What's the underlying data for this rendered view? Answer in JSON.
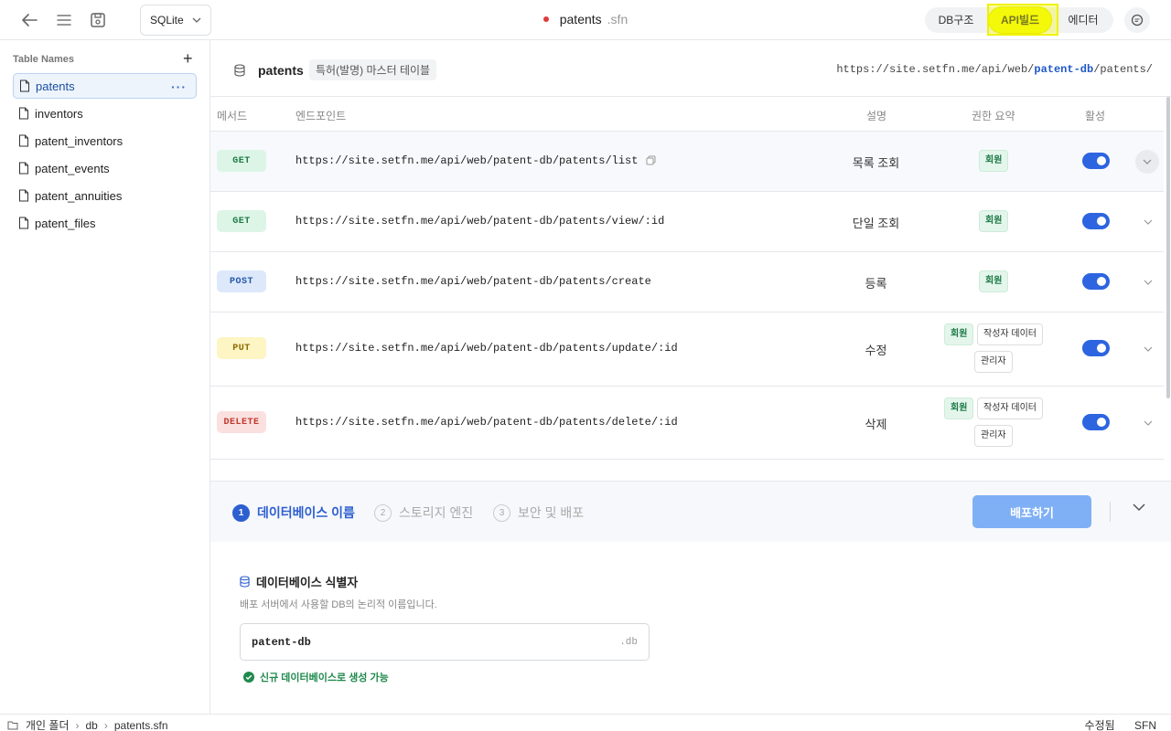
{
  "toolbar": {
    "db_engine": "SQLite",
    "file_name": "patents",
    "file_ext": ".sfn",
    "tabs": [
      {
        "label": "DB구조"
      },
      {
        "label": "API빌드"
      },
      {
        "label": "에디터"
      }
    ]
  },
  "sidebar": {
    "header": "Table Names",
    "add": "+",
    "more": "···",
    "items": [
      {
        "label": "patents"
      },
      {
        "label": "inventors"
      },
      {
        "label": "patent_inventors"
      },
      {
        "label": "patent_events"
      },
      {
        "label": "patent_annuities"
      },
      {
        "label": "patent_files"
      }
    ]
  },
  "table": {
    "name": "patents",
    "description": "특허(발명) 마스터 테이블",
    "url_prefix": "https://site.setfn.me/api/web/",
    "url_db": "patent-db",
    "url_suffix": "/patents/",
    "columns": {
      "method": "메서드",
      "endpoint": "엔드포인트",
      "description": "설명",
      "permission": "권한 요약",
      "active": "활성"
    },
    "rows": [
      {
        "method": "GET",
        "endpoint": "https://site.setfn.me/api/web/patent-db/patents/list",
        "description": "목록 조회",
        "permissions": [
          "회원"
        ],
        "active": true
      },
      {
        "method": "GET",
        "endpoint": "https://site.setfn.me/api/web/patent-db/patents/view/:id",
        "description": "단일 조회",
        "permissions": [
          "회원"
        ],
        "active": true
      },
      {
        "method": "POST",
        "endpoint": "https://site.setfn.me/api/web/patent-db/patents/create",
        "description": "등록",
        "permissions": [
          "회원"
        ],
        "active": true
      },
      {
        "method": "PUT",
        "endpoint": "https://site.setfn.me/api/web/patent-db/patents/update/:id",
        "description": "수정",
        "permissions": [
          "회원",
          "작성자 데이터",
          "관리자"
        ],
        "active": true
      },
      {
        "method": "DELETE",
        "endpoint": "https://site.setfn.me/api/web/patent-db/patents/delete/:id",
        "description": "삭제",
        "permissions": [
          "회원",
          "작성자 데이터",
          "관리자"
        ],
        "active": true
      }
    ]
  },
  "deploy": {
    "steps": [
      {
        "num": "1",
        "label": "데이터베이스 이름"
      },
      {
        "num": "2",
        "label": "스토리지 엔진"
      },
      {
        "num": "3",
        "label": "보안 및 배포"
      }
    ],
    "deploy_button": "배포하기",
    "section_title": "데이터베이스 식별자",
    "section_help": "배포 서버에서 사용할 DB의 논리적 이름입니다.",
    "db_name": "patent-db",
    "db_suffix": ".db",
    "status": "신규 데이터베이스로 생성 가능"
  },
  "statusbar": {
    "crumbs": [
      "개인 폴더",
      "db",
      "patents.sfn"
    ],
    "saved": "수정됨",
    "format": "SFN"
  },
  "colors": {
    "accent": "#2d64e0",
    "highlight": "#f4f80a",
    "get": "#1f7a48",
    "post": "#2456a8",
    "put": "#8a6a00",
    "delete": "#c0392b"
  }
}
